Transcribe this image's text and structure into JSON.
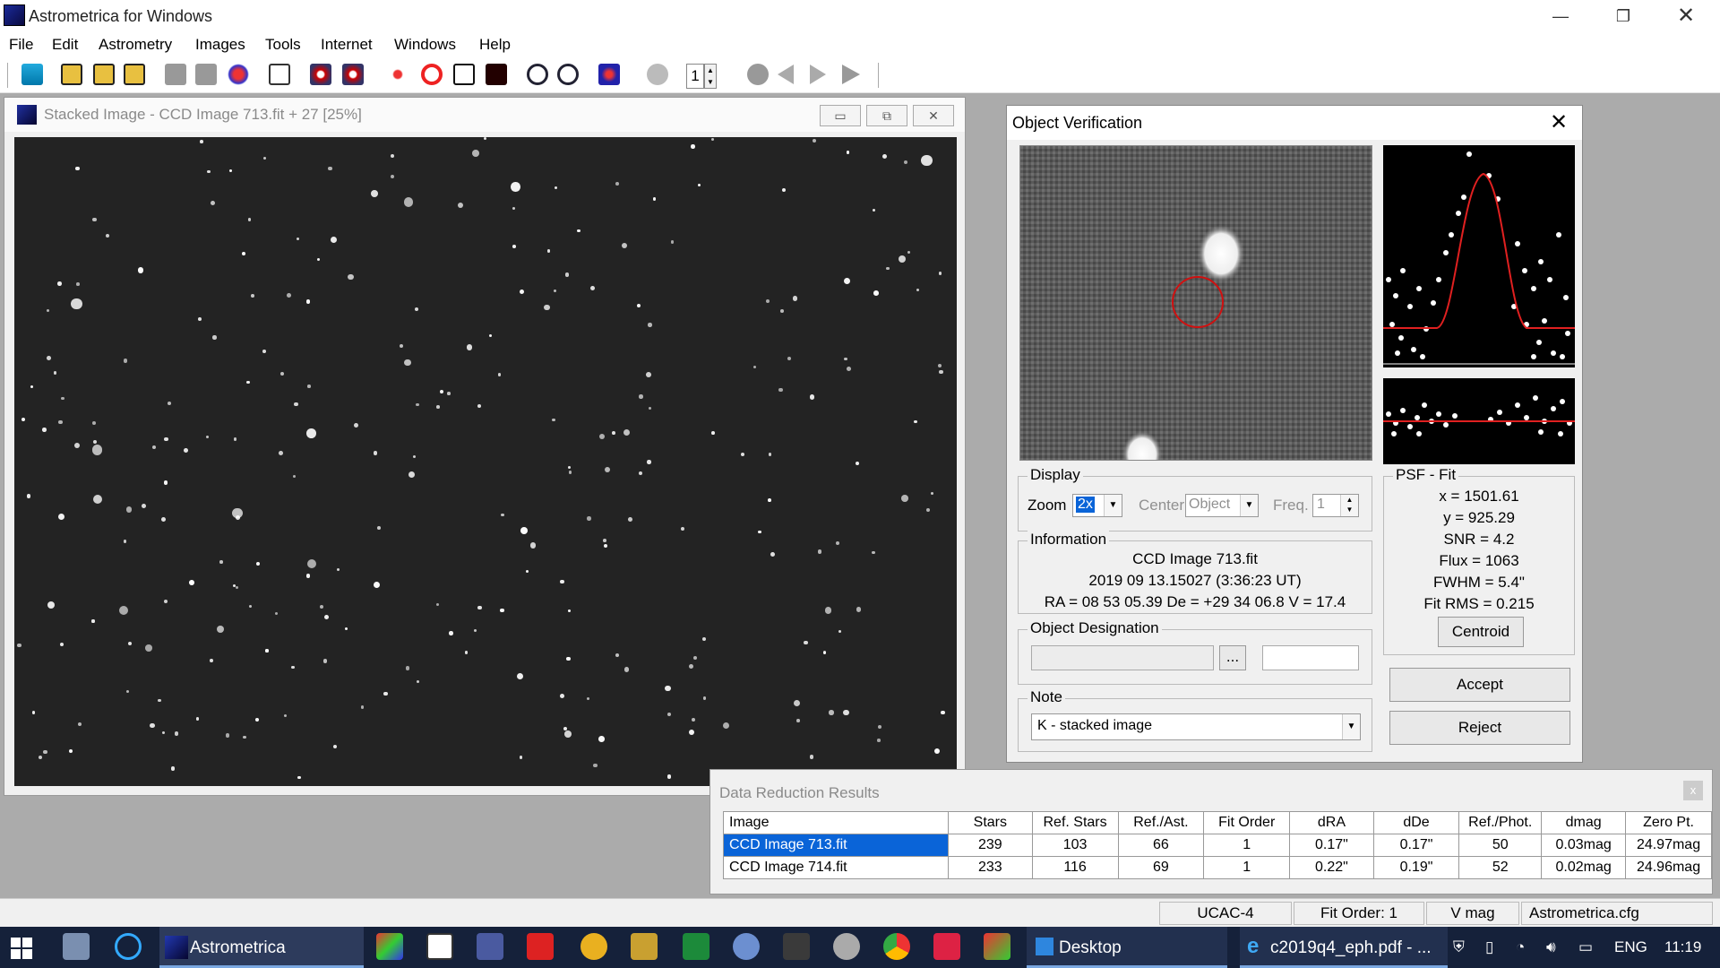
{
  "app": {
    "title": "Astrometrica for Windows",
    "menu": [
      "File",
      "Edit",
      "Astrometry",
      "Images",
      "Tools",
      "Internet",
      "Windows",
      "Help"
    ],
    "toolbar_spin_value": "1"
  },
  "stack_window": {
    "title": "Stacked Image - CCD Image 713.fit + 27 [25%]"
  },
  "object_verification": {
    "title": "Object Verification",
    "display": {
      "label": "Display",
      "zoom_label": "Zoom",
      "zoom_value": "2x",
      "center_label": "Center",
      "center_value": "Object",
      "freq_label": "Freq.",
      "freq_value": "1"
    },
    "information": {
      "label": "Information",
      "line1": "CCD Image 713.fit",
      "line2": "2019 09 13.15027 (3:36:23 UT)",
      "line3": "RA = 08 53 05.39   De = +29 34 06.8   V = 17.4"
    },
    "designation": {
      "label": "Object Designation",
      "browse_label": "..."
    },
    "note": {
      "label": "Note",
      "value": "K - stacked image"
    },
    "psf_fit": {
      "label": "PSF - Fit",
      "x": "x = 1501.61",
      "y": "y = 925.29",
      "snr": "SNR = 4.2",
      "flux": "Flux = 1063",
      "fwhm": "FWHM = 5.4\"",
      "fit_rms": "Fit RMS = 0.215",
      "centroid_label": "Centroid"
    },
    "accept_label": "Accept",
    "reject_label": "Reject"
  },
  "data_reduction": {
    "title": "Data Reduction Results",
    "close_label": "x",
    "columns": [
      "Image",
      "Stars",
      "Ref. Stars",
      "Ref./Ast.",
      "Fit Order",
      "dRA",
      "dDe",
      "Ref./Phot.",
      "dmag",
      "Zero Pt."
    ],
    "rows": [
      [
        "CCD Image 713.fit",
        "239",
        "103",
        "66",
        "1",
        "0.17\"",
        "0.17\"",
        "50",
        "0.03mag",
        "24.97mag"
      ],
      [
        "CCD Image 714.fit",
        "233",
        "116",
        "69",
        "1",
        "0.22\"",
        "0.19\"",
        "52",
        "0.02mag",
        "24.96mag"
      ]
    ]
  },
  "statusbar": {
    "catalog": "UCAC-4",
    "fit_order": "Fit Order: 1",
    "band": "V mag",
    "config": "Astrometrica.cfg"
  },
  "taskbar": {
    "astrometrica_label": "Astrometrica",
    "desktop_label": "Desktop",
    "pdf_label": "c2019q4_eph.pdf - ...",
    "language": "ENG",
    "time": "11:19"
  }
}
